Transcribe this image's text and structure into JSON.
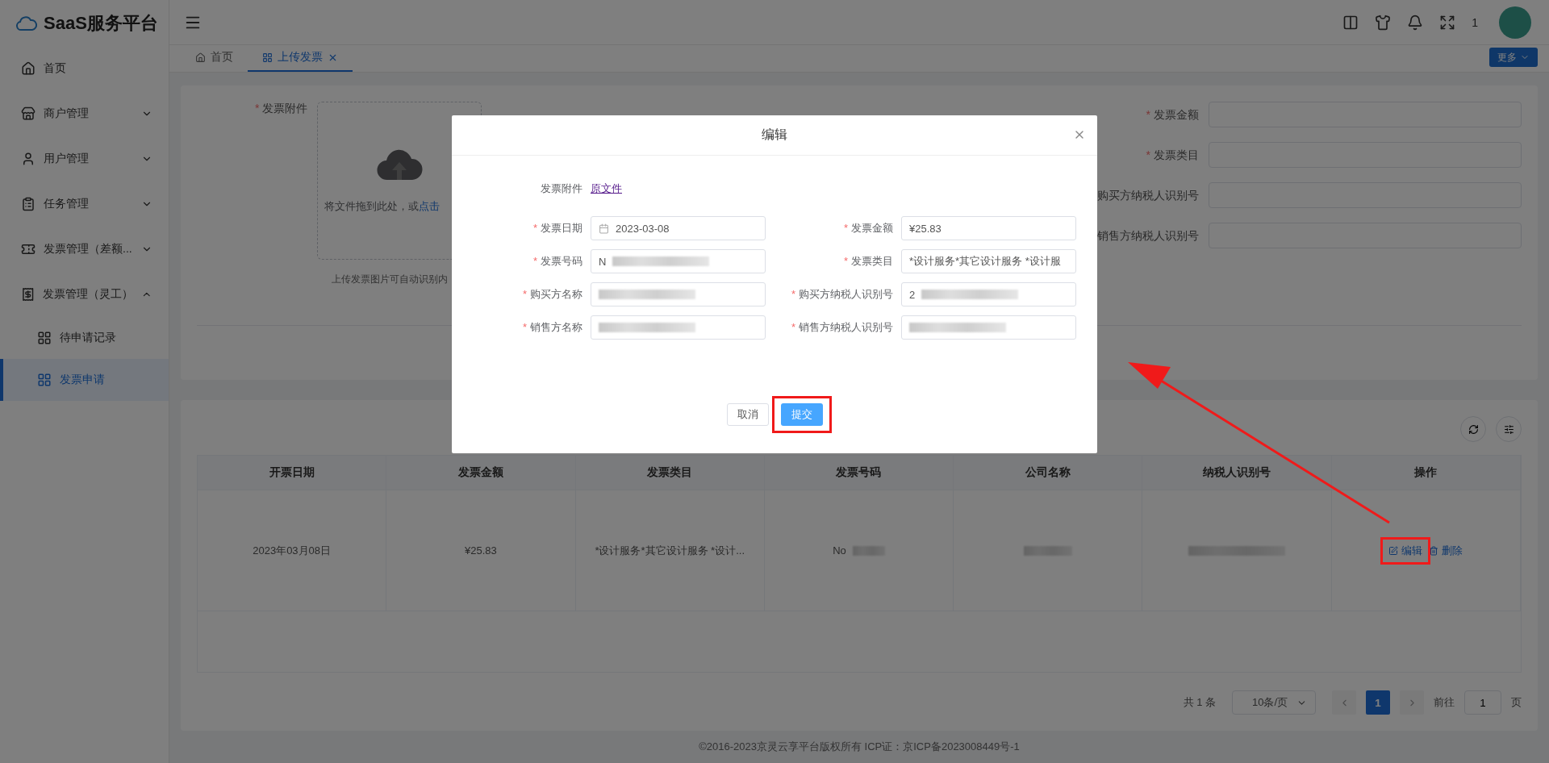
{
  "brand": {
    "name": "SaaS服务平台"
  },
  "required_mark": "*",
  "sidebar": {
    "items": [
      {
        "label": "首页",
        "selected": false
      },
      {
        "label": "商户管理",
        "expanded": false,
        "selected": false
      },
      {
        "label": "用户管理",
        "expanded": false,
        "selected": false
      },
      {
        "label": "任务管理",
        "expanded": false,
        "selected": false
      },
      {
        "label": "发票管理（差额...",
        "expanded": false,
        "selected": false
      },
      {
        "label": "发票管理（灵工）",
        "expanded": true,
        "selected": false,
        "children": [
          {
            "label": "待申请记录",
            "selected": false
          },
          {
            "label": "发票申请",
            "selected": true
          }
        ]
      }
    ]
  },
  "header": {
    "user_count": "1"
  },
  "tabs": [
    {
      "label": "首页",
      "selected": false,
      "closable": false
    },
    {
      "label": "上传发票",
      "selected": true,
      "closable": true
    }
  ],
  "more_button": "更多",
  "upload_form": {
    "label": "发票附件",
    "drop_text": "将文件拖到此处，或",
    "drop_link": "点击",
    "hint": "上传发票图片可自动识别内",
    "right_fields": [
      {
        "label": "发票金额",
        "required": true
      },
      {
        "label": "发票类目",
        "required": true
      },
      {
        "label": "购买方纳税人识别号"
      },
      {
        "label": "销售方纳税人识别号"
      }
    ]
  },
  "table": {
    "columns": [
      "开票日期",
      "发票金额",
      "发票类目",
      "发票号码",
      "公司名称",
      "纳税人识别号",
      "操作"
    ],
    "rows": [
      {
        "cells": [
          {
            "text": "2023年03月08日",
            "redacted": false
          },
          {
            "text": "¥25.83",
            "redacted": false
          },
          {
            "text": "*设计服务*其它设计服务 *设计...",
            "redacted": false
          },
          {
            "text": "No",
            "redacted": true
          },
          {
            "redacted": true
          },
          {
            "redacted": true
          }
        ],
        "actions": [
          {
            "kind": "edit",
            "label": "编辑",
            "highlighted": true
          },
          {
            "kind": "delete",
            "label": "删除",
            "highlighted": false
          }
        ]
      }
    ]
  },
  "pagination": {
    "total": "共 1 条",
    "page_size": "10条/页",
    "pages": [
      {
        "label": "1",
        "selected": true
      }
    ],
    "goto_label": "前往",
    "goto_value": "1",
    "goto_unit": "页"
  },
  "footer": "©2016-2023京灵云享平台版权所有 ICP证：京ICP备2023008449号-1",
  "dialog": {
    "title": "编辑",
    "attachment_label": "发票附件",
    "attachment_link": "原文件",
    "fields": [
      {
        "label": "发票日期",
        "kind": "date",
        "value": "2023-03-08",
        "required": true,
        "redacted": false
      },
      {
        "label": "发票金额",
        "kind": "text",
        "value": "¥25.83",
        "required": true,
        "redacted": false
      },
      {
        "label": "发票号码",
        "kind": "text",
        "value": "N",
        "required": true,
        "redacted": true
      },
      {
        "label": "发票类目",
        "kind": "text",
        "value": "*设计服务*其它设计服务 *设计服",
        "required": true,
        "redacted": false
      },
      {
        "label": "购买方名称",
        "kind": "text",
        "required": true,
        "redacted": true
      },
      {
        "label": "购买方纳税人识别号",
        "kind": "text",
        "value": "2",
        "required": true,
        "redacted": true
      },
      {
        "label": "销售方名称",
        "kind": "text",
        "required": true,
        "redacted": true
      },
      {
        "label": "销售方纳税人识别号",
        "kind": "text",
        "required": true,
        "redacted": true
      }
    ],
    "cancel": {
      "label": "取消",
      "highlighted": false
    },
    "submit": {
      "label": "提交",
      "highlighted": true
    }
  }
}
